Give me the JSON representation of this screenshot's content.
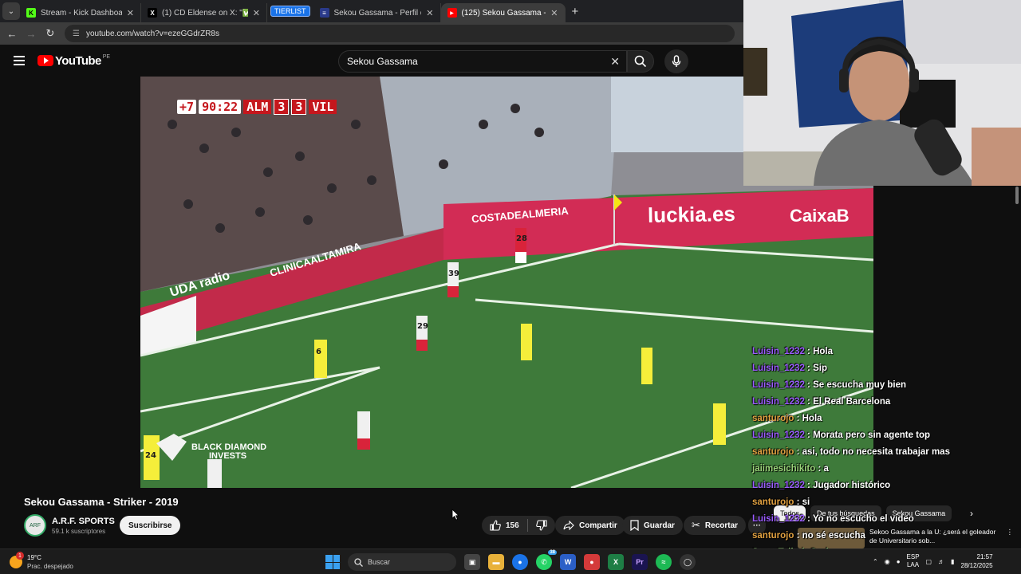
{
  "browser": {
    "tabs": [
      {
        "label": "Stream - Kick Dashboard",
        "fav_color": "#53fc18",
        "fav_char": "K"
      },
      {
        "label": "(1) CD Eldense on X: \"✅ OFICI",
        "fav_color": "#000000",
        "fav_char": "X"
      },
      {
        "label": "Sekou Gassama - Perfil del juga",
        "fav_color": "#2a3a8a",
        "fav_char": "≡"
      },
      {
        "label": "(125) Sekou Gassama - Striker -",
        "fav_color": "#ff0000",
        "fav_char": "▶"
      }
    ],
    "tierlist_label": "TIERLIST",
    "url": "youtube.com/watch?v=ezeGGdrZR8s"
  },
  "youtube": {
    "logo_text": "YouTube",
    "country_code": "PE",
    "search_value": "Sekou Gassama"
  },
  "video_overlay": {
    "added_time": "+7",
    "clock": "90:22",
    "home_team": "ALM",
    "home_score": "3",
    "away_score": "3",
    "away_team": "VIL",
    "sponsor_line1": "BLACK DIAMOND",
    "sponsor_line2": "INVESTS",
    "boards": [
      "luckia.es",
      "COSTADEALMERIA",
      "CLINICAALTAMIRA",
      "UDA radio",
      "CaixaB"
    ]
  },
  "video": {
    "title": "Sekou Gassama - Striker - 2019",
    "channel_name": "A.R.F. SPORTS",
    "channel_subs": "59.1 k suscriptores",
    "subscribe_label": "Suscribirse",
    "like_count": "156",
    "share_label": "Compartir",
    "save_label": "Guardar",
    "clip_label": "Recortar"
  },
  "chat": [
    {
      "user": "Luisin_1232",
      "msg": "Hola",
      "color": "u1"
    },
    {
      "user": "Luisin_1232",
      "msg": "Sip",
      "color": "u1"
    },
    {
      "user": "Luisin_1232",
      "msg": "Se escucha muy bien",
      "color": "u1"
    },
    {
      "user": "Luisin_1232",
      "msg": "El Real Barcelona",
      "color": "u1"
    },
    {
      "user": "santurojo",
      "msg": "Hola",
      "color": "u2"
    },
    {
      "user": "Luisin_1232",
      "msg": "Morata pero sin agente top",
      "color": "u1"
    },
    {
      "user": "santurojo",
      "msg": "asi, todo no necesita trabajar mas",
      "color": "u2"
    },
    {
      "user": "jaiimesichikito",
      "msg": "a",
      "color": "u3"
    },
    {
      "user": "Luisin_1232",
      "msg": "Jugador histórico",
      "color": "u1"
    },
    {
      "user": "santurojo",
      "msg": "si",
      "color": "u2"
    },
    {
      "user": "Luisin_1232",
      "msg": "Yo no escucho el video",
      "color": "u1"
    },
    {
      "user": "santurojo",
      "msg": "no sé escucha",
      "color": "u2"
    },
    {
      "user": "SuperTallarinGod",
      "msg": " ",
      "color": "u3"
    }
  ],
  "chips": [
    "Todos",
    "De tus búsquedas",
    "Sekou Gassama"
  ],
  "recommendation": {
    "text": "Sekoo Gassama a la U: ¿será el goleador de Universitario sob..."
  },
  "taskbar": {
    "weather_temp": "19°C",
    "weather_desc": "Prac. despejado",
    "weather_badge": "1",
    "search_placeholder": "Buscar",
    "lang_top": "ESP",
    "lang_bottom": "LAA",
    "time": "21:57",
    "date": "28/12/2025",
    "whatsapp_badge": "38"
  }
}
